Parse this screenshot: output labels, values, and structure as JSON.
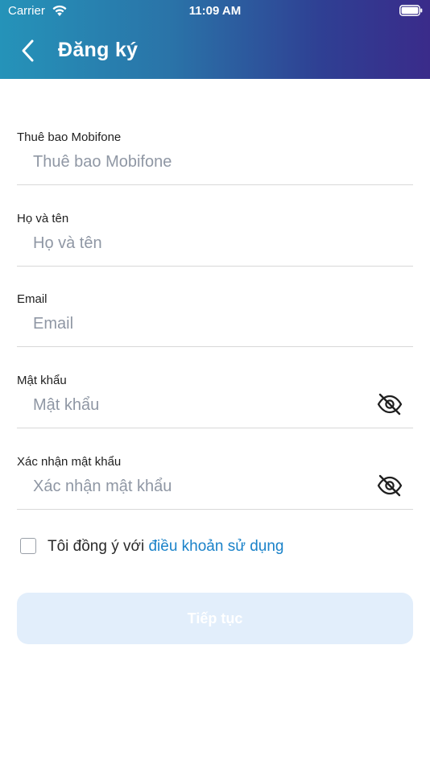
{
  "status_bar": {
    "carrier": "Carrier",
    "time": "11:09 AM",
    "icons": [
      "wifi-icon",
      "battery-icon"
    ]
  },
  "header": {
    "title": "Đăng ký",
    "back_icon": "chevron-left-icon",
    "gradient_colors": [
      "#2593b9",
      "#2f3f93",
      "#3a2b8a"
    ]
  },
  "form": {
    "fields": [
      {
        "label": "Thuê bao Mobifone",
        "placeholder": "Thuê bao Mobifone",
        "value": ""
      },
      {
        "label": "Họ và tên",
        "placeholder": "Họ và tên",
        "value": ""
      },
      {
        "label": "Email",
        "placeholder": "Email",
        "value": ""
      },
      {
        "label": "Mật khẩu",
        "placeholder": "Mật khẩu",
        "value": "",
        "toggle_icon": "eye-off-icon"
      },
      {
        "label": "Xác nhận mật khẩu",
        "placeholder": "Xác nhận mật khẩu",
        "value": "",
        "toggle_icon": "eye-off-icon"
      }
    ],
    "agree": {
      "checked": false,
      "prefix": "Tôi đồng ý với ",
      "link_text": "điều khoản sử dụng",
      "link_color": "#1a82c9"
    },
    "submit_label": "Tiếp tục",
    "submit_bg_color": "#e2eefb"
  }
}
